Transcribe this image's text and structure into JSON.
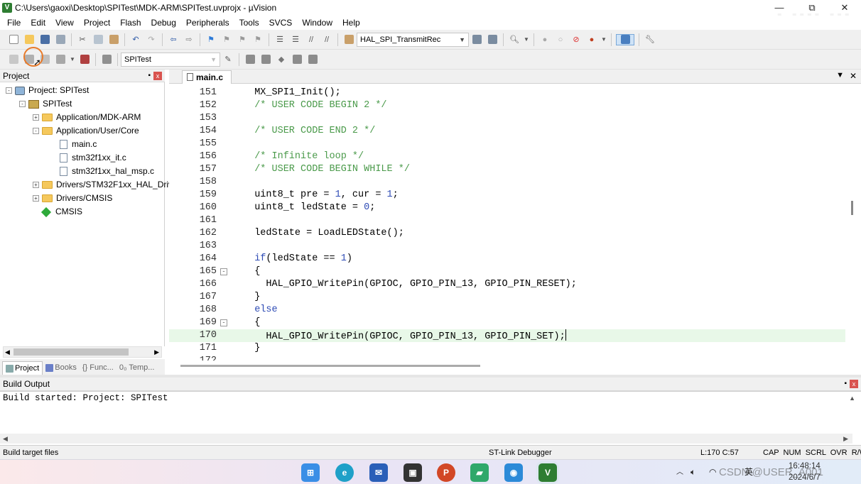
{
  "window": {
    "title": "C:\\Users\\gaoxi\\Desktop\\SPITest\\MDK-ARM\\SPITest.uvprojx - µVision",
    "minimize": "—",
    "maximize": "⧉",
    "close": "✕"
  },
  "watermark": "bilibili",
  "menu": [
    "File",
    "Edit",
    "View",
    "Project",
    "Flash",
    "Debug",
    "Peripherals",
    "Tools",
    "SVCS",
    "Window",
    "Help"
  ],
  "toolbar1": {
    "function_combo": "HAL_SPI_TransmitRec"
  },
  "toolbar2": {
    "target_combo": "SPITest"
  },
  "project_pane": {
    "title": "Project",
    "pin": "📌",
    "close": "x",
    "tree": [
      {
        "label": "Project: SPITest",
        "kind": "project",
        "expander": "-"
      },
      {
        "label": "SPITest",
        "kind": "target",
        "expander": "-"
      },
      {
        "label": "Application/MDK-ARM",
        "kind": "folder",
        "expander": "+"
      },
      {
        "label": "Application/User/Core",
        "kind": "folder",
        "expander": "-"
      },
      {
        "label": "main.c",
        "kind": "file",
        "expander": ""
      },
      {
        "label": "stm32f1xx_it.c",
        "kind": "file",
        "expander": ""
      },
      {
        "label": "stm32f1xx_hal_msp.c",
        "kind": "file",
        "expander": ""
      },
      {
        "label": "Drivers/STM32F1xx_HAL_Driv",
        "kind": "folder",
        "expander": "+"
      },
      {
        "label": "Drivers/CMSIS",
        "kind": "folder",
        "expander": "+"
      },
      {
        "label": "CMSIS",
        "kind": "component",
        "expander": ""
      }
    ],
    "tabs": [
      "Project",
      "Books",
      "{} Func...",
      "0₀ Temp..."
    ]
  },
  "editor": {
    "tab": "main.c",
    "lines": [
      {
        "n": "151",
        "fold": "",
        "parts": [
          [
            "",
            "  MX_SPI1_Init();"
          ]
        ]
      },
      {
        "n": "152",
        "fold": "",
        "parts": [
          [
            "cm",
            "  /* USER CODE BEGIN 2 */"
          ]
        ]
      },
      {
        "n": "153",
        "fold": "",
        "parts": [
          [
            "",
            ""
          ]
        ]
      },
      {
        "n": "154",
        "fold": "",
        "parts": [
          [
            "cm",
            "  /* USER CODE END 2 */"
          ]
        ]
      },
      {
        "n": "155",
        "fold": "",
        "parts": [
          [
            "",
            ""
          ]
        ]
      },
      {
        "n": "156",
        "fold": "",
        "parts": [
          [
            "cm",
            "  /* Infinite loop */"
          ]
        ]
      },
      {
        "n": "157",
        "fold": "",
        "parts": [
          [
            "cm",
            "  /* USER CODE BEGIN WHILE */"
          ]
        ]
      },
      {
        "n": "158",
        "fold": "",
        "parts": [
          [
            "",
            ""
          ]
        ]
      },
      {
        "n": "159",
        "fold": "",
        "parts": [
          [
            "",
            "  uint8_t pre = "
          ],
          [
            "num",
            "1"
          ],
          [
            "",
            ", cur = "
          ],
          [
            "num",
            "1"
          ],
          [
            "",
            ";"
          ]
        ]
      },
      {
        "n": "160",
        "fold": "",
        "parts": [
          [
            "",
            "  uint8_t ledState = "
          ],
          [
            "num",
            "0"
          ],
          [
            "",
            ";"
          ]
        ]
      },
      {
        "n": "161",
        "fold": "",
        "parts": [
          [
            "",
            ""
          ]
        ]
      },
      {
        "n": "162",
        "fold": "",
        "parts": [
          [
            "",
            "  ledState = LoadLEDState();"
          ]
        ]
      },
      {
        "n": "163",
        "fold": "",
        "parts": [
          [
            "",
            ""
          ]
        ]
      },
      {
        "n": "164",
        "fold": "",
        "parts": [
          [
            "kw",
            "  if"
          ],
          [
            "",
            "(ledState == "
          ],
          [
            "num",
            "1"
          ],
          [
            "",
            ")"
          ]
        ]
      },
      {
        "n": "165",
        "fold": "-",
        "parts": [
          [
            "",
            "  {"
          ]
        ]
      },
      {
        "n": "166",
        "fold": "",
        "parts": [
          [
            "",
            "    HAL_GPIO_WritePin(GPIOC, GPIO_PIN_13, GPIO_PIN_RESET);"
          ]
        ]
      },
      {
        "n": "167",
        "fold": "",
        "parts": [
          [
            "",
            "  }"
          ]
        ]
      },
      {
        "n": "168",
        "fold": "",
        "parts": [
          [
            "kw",
            "  else"
          ]
        ]
      },
      {
        "n": "169",
        "fold": "-",
        "parts": [
          [
            "",
            "  {"
          ]
        ]
      },
      {
        "n": "170",
        "fold": "",
        "parts": [
          [
            "",
            "    HAL_GPIO_WritePin(GPIOC, GPIO_PIN_13, GPIO_PIN_SET);"
          ]
        ],
        "current": true
      },
      {
        "n": "171",
        "fold": "",
        "parts": [
          [
            "",
            "  }"
          ]
        ]
      },
      {
        "n": "172",
        "fold": "",
        "parts": [
          [
            "",
            ""
          ]
        ]
      }
    ]
  },
  "build_output": {
    "title": "Build Output",
    "text": "Build started: Project: SPITest"
  },
  "status": {
    "left": "Build target files",
    "debugger": "ST-Link Debugger",
    "position": "L:170 C:57",
    "flags": "CAP  NUM  SCRL  OVR  R/W"
  },
  "taskbar": {
    "ime": "英",
    "time": "16:48:14",
    "date": "2024/6/7",
    "overlay": "CSDN @USER_A001"
  }
}
